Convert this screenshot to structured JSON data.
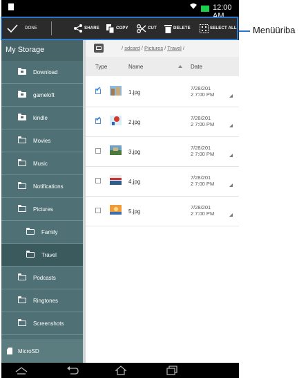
{
  "status_bar": {
    "time": "12:00 AM"
  },
  "action_bar": {
    "done": "DONE",
    "share": "SHARE",
    "copy": "COPY",
    "cut": "CUT",
    "delete": "DELETE",
    "select_all": "SELECT ALL"
  },
  "annotation": {
    "label": "Menüüriba"
  },
  "sidebar": {
    "title": "My Storage",
    "items": [
      {
        "label": "Download"
      },
      {
        "label": "gameloft"
      },
      {
        "label": "kindle"
      },
      {
        "label": "Movies"
      },
      {
        "label": "Music"
      },
      {
        "label": "Notifications"
      },
      {
        "label": "Pictures"
      },
      {
        "label": "Family"
      },
      {
        "label": "Travel"
      },
      {
        "label": "Podcasts"
      },
      {
        "label": "Ringtones"
      },
      {
        "label": "Screenshots"
      }
    ],
    "microsd": "MicroSD"
  },
  "path": {
    "sep": "/",
    "sdcard": "sdcard",
    "pictures": "Pictures",
    "travel": "Travel"
  },
  "columns": {
    "type": "Type",
    "name": "Name",
    "date": "Date"
  },
  "files": [
    {
      "name": "1.jpg",
      "date1": "7/28/201",
      "date2": "2 7:00 PM",
      "checked": true
    },
    {
      "name": "2.jpg",
      "date1": "7/28/201",
      "date2": "2 7:00 PM",
      "checked": true
    },
    {
      "name": "3.jpg",
      "date1": "7/28/201",
      "date2": "2 7:00 PM",
      "checked": false
    },
    {
      "name": "4.jpg",
      "date1": "7/28/201",
      "date2": "2 7:00 PM",
      "checked": false
    },
    {
      "name": "5.jpg",
      "date1": "7/28/201",
      "date2": "2 7:00 PM",
      "checked": false
    }
  ],
  "colors": {
    "sidebar": "#4f7074",
    "accent": "#2d77c9",
    "battery": "#18d24c"
  }
}
